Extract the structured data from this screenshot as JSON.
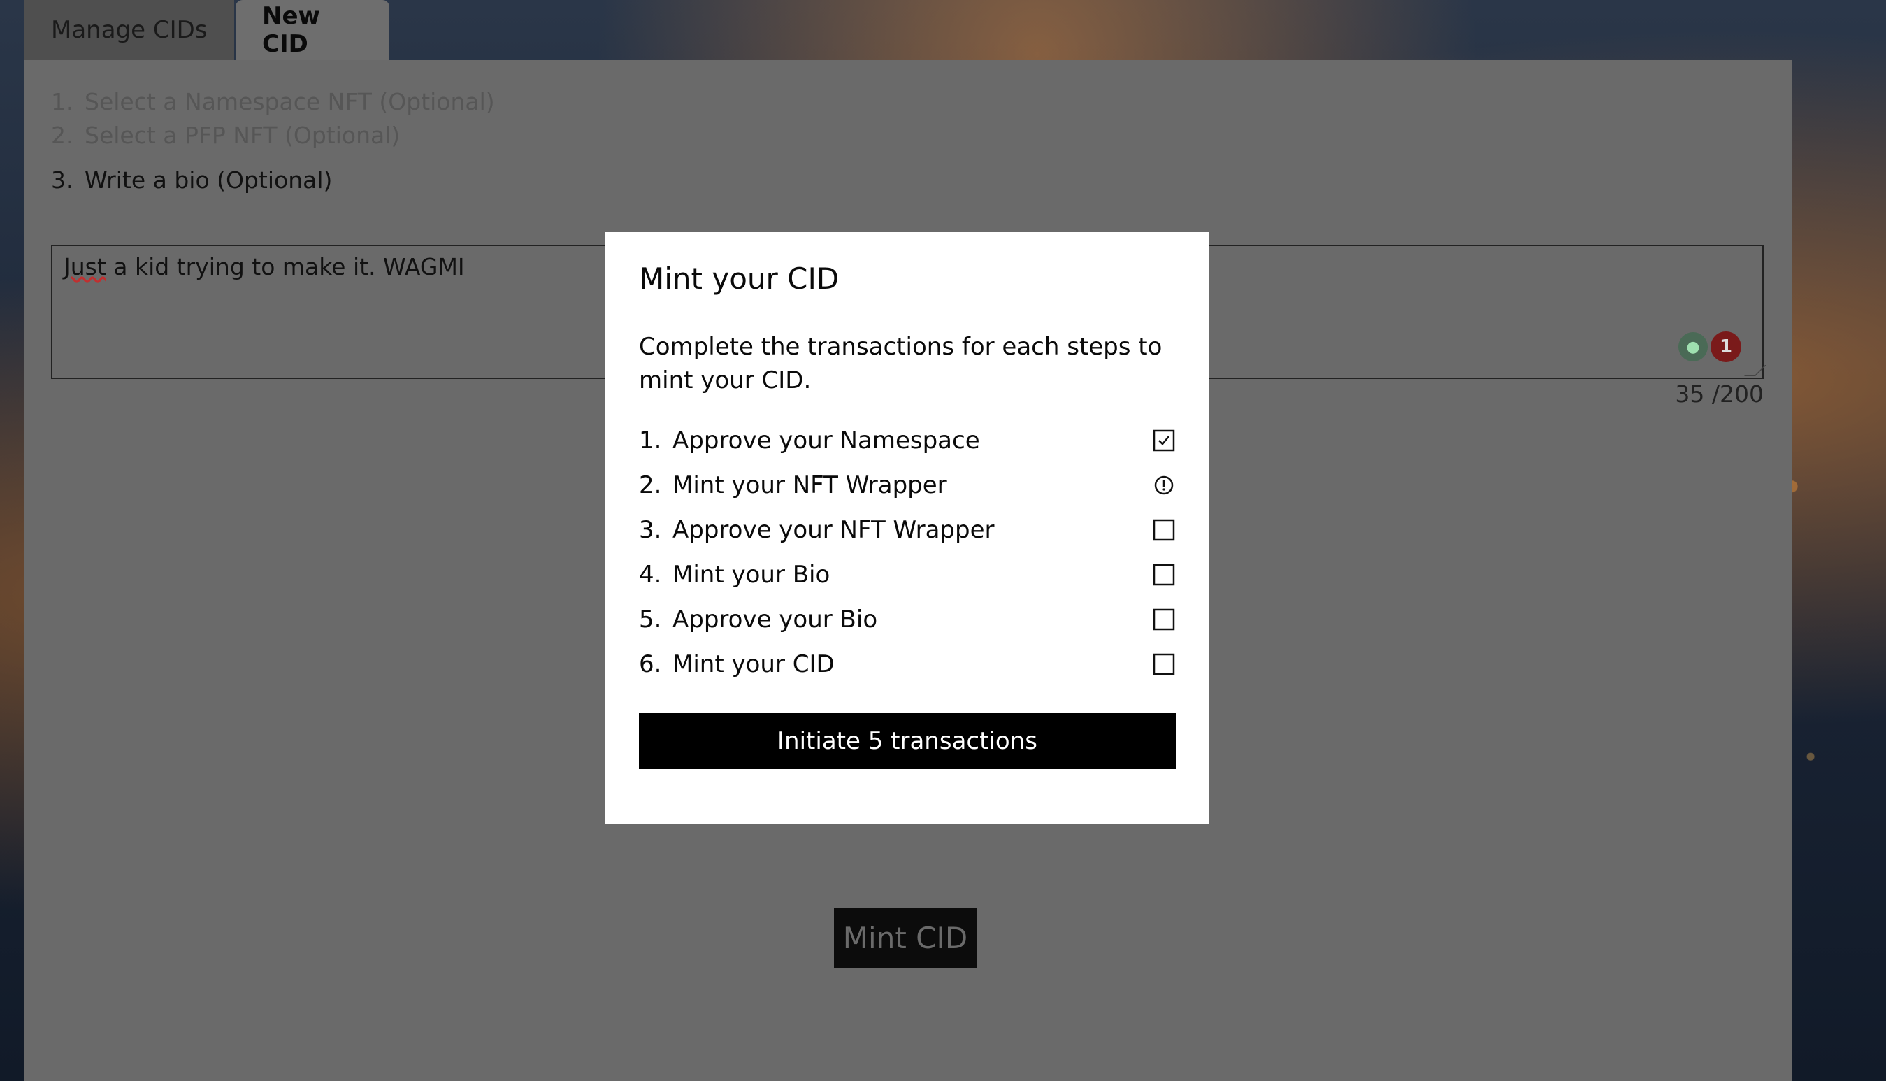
{
  "tabs": [
    {
      "label": "Manage CIDs",
      "active": false
    },
    {
      "label": "New CID",
      "active": true
    }
  ],
  "form": {
    "steps": [
      {
        "num": "1.",
        "label": "Select a Namespace NFT (Optional)"
      },
      {
        "num": "2.",
        "label": "Select a PFP NFT (Optional)"
      },
      {
        "num": "3.",
        "label": "Write a bio (Optional)"
      }
    ],
    "bio_first_word": "Just",
    "bio_rest": " a kid trying to make it. WAGMI",
    "extension_badge_count": "1",
    "char_count": "35 /200",
    "mint_button_label": "Mint CID"
  },
  "modal": {
    "title": "Mint your CID",
    "description": "Complete the transactions for each steps to mint your CID.",
    "transactions": [
      {
        "num": "1.",
        "label": "Approve your Namespace",
        "status": "checked"
      },
      {
        "num": "2.",
        "label": "Mint your NFT Wrapper",
        "status": "pending"
      },
      {
        "num": "3.",
        "label": "Approve your NFT Wrapper",
        "status": "unchecked"
      },
      {
        "num": "4.",
        "label": "Mint your Bio",
        "status": "unchecked"
      },
      {
        "num": "5.",
        "label": "Approve your Bio",
        "status": "unchecked"
      },
      {
        "num": "6.",
        "label": "Mint your CID",
        "status": "unchecked"
      }
    ],
    "initiate_button_label": "Initiate 5 transactions"
  },
  "icons": {
    "checked": "checkbox-checked-icon",
    "pending": "alert-circle-icon",
    "unchecked": "checkbox-empty-icon"
  }
}
